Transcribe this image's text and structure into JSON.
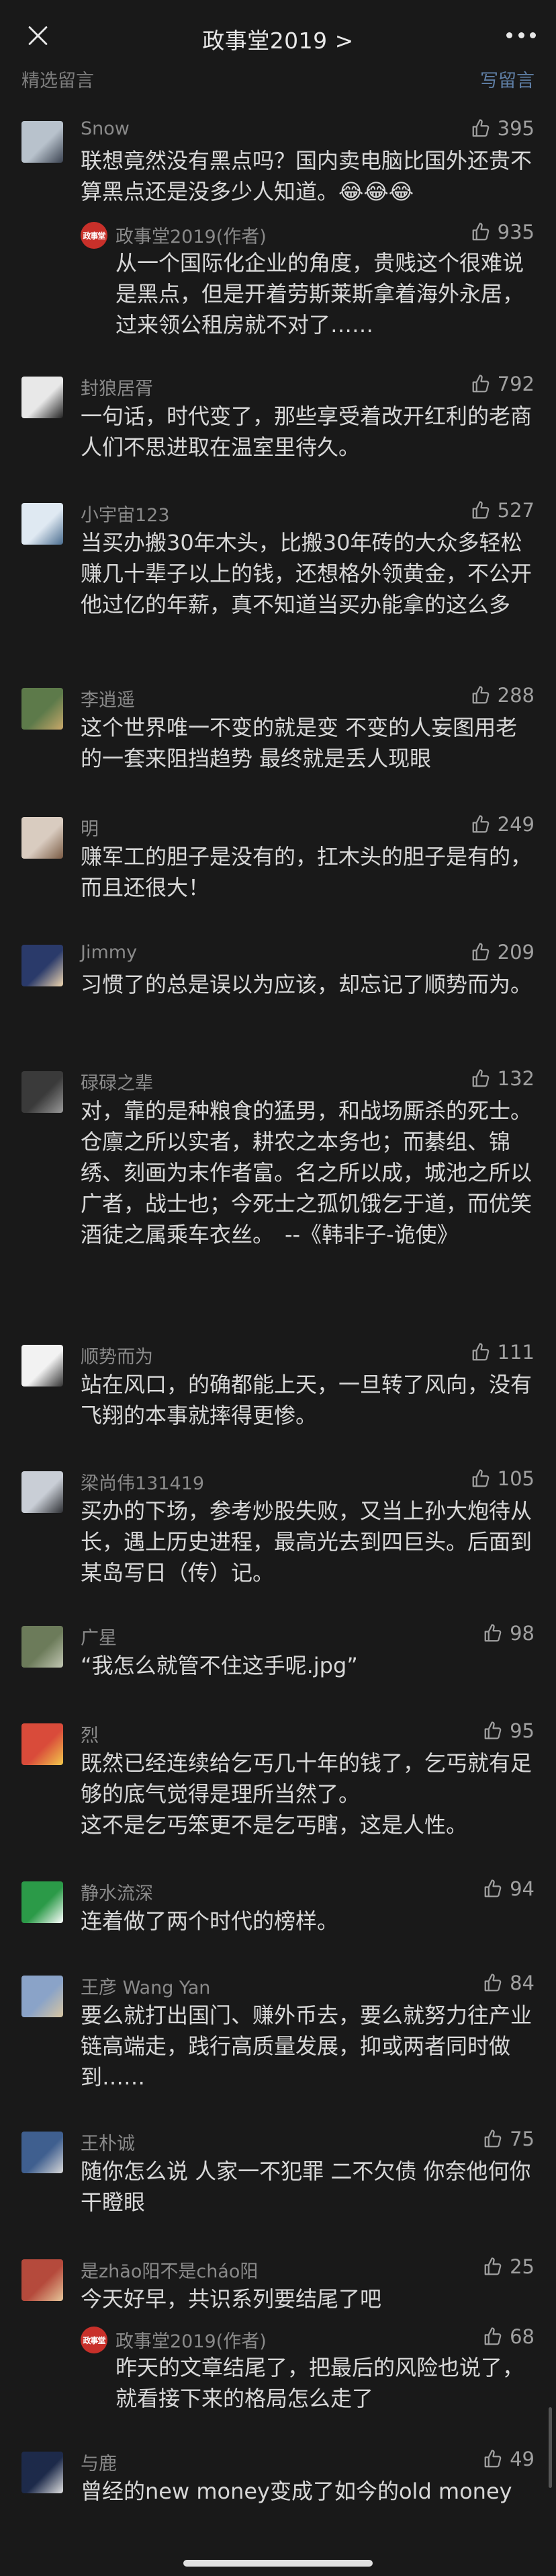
{
  "nav": {
    "title": "政事堂2019 >"
  },
  "section": {
    "title": "精选留言",
    "write_label": "写留言"
  },
  "comments": [
    {
      "nick": "Snow",
      "likes": "395",
      "text": "联想竟然没有黑点吗？国内卖电脑比国外还贵不算黑点还是没多少人知道。😂😂😂",
      "reply": {
        "nick": "政事堂2019(作者)",
        "likes": "935",
        "text": "从一个国际化企业的角度，贵贱这个很难说是黑点，但是开着劳斯莱斯拿着海外永居，过来领公租房就不对了……"
      }
    },
    {
      "nick": "封狼居胥",
      "likes": "792",
      "text": "一句话，时代变了，那些享受着改开红利的老商人们不思进取在温室里待久。"
    },
    {
      "nick": "小宇宙123",
      "likes": "527",
      "text": "当买办搬30年木头，比搬30年砖的大众多轻松赚几十辈子以上的钱，还想格外领黄金，不公开他过亿的年薪，真不知道当买办能拿的这么多"
    },
    {
      "nick": "李逍遥",
      "likes": "288",
      "text": "这个世界唯一不变的就是变 不变的人妄图用老的一套来阻挡趋势 最终就是丢人现眼"
    },
    {
      "nick": "明",
      "likes": "249",
      "text": "赚军工的胆子是没有的，扛木头的胆子是有的，而且还很大！"
    },
    {
      "nick": "Jimmy",
      "likes": "209",
      "text": "习惯了的总是误以为应该，却忘记了顺势而为。"
    },
    {
      "nick": "碌碌之辈",
      "likes": "132",
      "text": "对，靠的是种粮食的猛男，和战场厮杀的死士。\n仓廪之所以实者，耕农之本务也；而綦组、锦绣、刻画为末作者富。名之所以成，城池之所以广者，战士也；今死士之孤饥饿乞于道，而优笑酒徒之属乘车衣丝。　--《韩非子-诡使》"
    },
    {
      "nick": "顺势而为",
      "likes": "111",
      "text": "站在风口，的确都能上天，一旦转了风向，没有飞翔的本事就摔得更惨。"
    },
    {
      "nick": "梁尚伟131419",
      "likes": "105",
      "text": "买办的下场，参考炒股失败，又当上孙大炮待从长，遇上历史进程，最高光去到四巨头。后面到某岛写日（传）记。"
    },
    {
      "nick": "广星",
      "likes": "98",
      "text": "“我怎么就管不住这手呢.jpg”"
    },
    {
      "nick": "烈",
      "likes": "95",
      "text": "既然已经连续给乞丐几十年的钱了，乞丐就有足够的底气觉得是理所当然了。\n这不是乞丐笨更不是乞丐瞎，这是人性。"
    },
    {
      "nick": "静水流深",
      "likes": "94",
      "text": "连着做了两个时代的榜样。"
    },
    {
      "nick": "王彦 Wang Yan",
      "likes": "84",
      "text": "要么就打出国门、赚外币去，要么就努力往产业链高端走，践行高质量发展，抑或两者同时做到……"
    },
    {
      "nick": "王朴诚",
      "likes": "75",
      "text": "随你怎么说 人家一不犯罪 二不欠债 你奈他何你干瞪眼"
    },
    {
      "nick": "是zhāo阳不是cháo阳",
      "likes": "25",
      "text": "今天好早，共识系列要结尾了吧",
      "reply": {
        "nick": "政事堂2019(作者)",
        "likes": "68",
        "text": "昨天的文章结尾了，把最后的风险也说了，就看接下来的格局怎么走了"
      }
    },
    {
      "nick": "与鹿",
      "likes": "49",
      "text": "曾经的new money变成了如今的old money"
    }
  ],
  "author_badge": "政事堂"
}
